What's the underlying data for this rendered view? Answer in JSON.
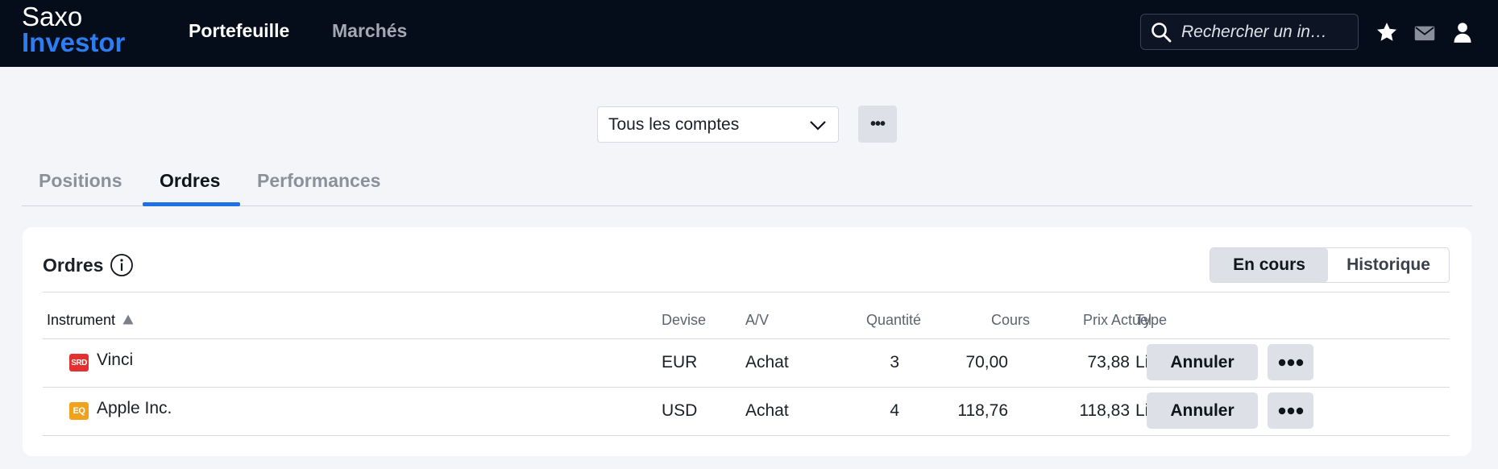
{
  "app": {
    "logo_line1": "Saxo",
    "logo_line2": "Investor",
    "brand_color": "#2d7df0",
    "nav": [
      {
        "label": "Portefeuille",
        "active": true
      },
      {
        "label": "Marchés",
        "active": false
      }
    ],
    "search": {
      "placeholder": "Rechercher un in…"
    },
    "icons": [
      "search-icon",
      "star-icon",
      "mail-icon",
      "user-icon"
    ]
  },
  "account": {
    "selected": "Tous les comptes",
    "more_label": "•••"
  },
  "tabs": [
    {
      "label": "Positions",
      "active": false
    },
    {
      "label": "Ordres",
      "active": true
    },
    {
      "label": "Performances",
      "active": false
    }
  ],
  "orders": {
    "title": "Ordres",
    "toggle": [
      {
        "label": "En cours",
        "active": true
      },
      {
        "label": "Historique",
        "active": false
      }
    ],
    "columns": {
      "instrument": "Instrument",
      "devise": "Devise",
      "av": "A/V",
      "quantite": "Quantité",
      "cours": "Cours",
      "prix_actuel": "Prix Actuel",
      "type": "Type"
    },
    "rows": [
      {
        "badge": "SRD",
        "badge_color": "#e3312f",
        "instrument": "Vinci",
        "devise": "EUR",
        "av": "Achat",
        "quantite": "3",
        "cours": "70,00",
        "prix_actuel": "73,88",
        "type": "Limite",
        "action": "Annuler"
      },
      {
        "badge": "EQ",
        "badge_color": "#f0a21c",
        "instrument": "Apple Inc.",
        "devise": "USD",
        "av": "Achat",
        "quantite": "4",
        "cours": "118,76",
        "prix_actuel": "118,83",
        "type": "Limite",
        "action": "Annuler"
      }
    ]
  }
}
